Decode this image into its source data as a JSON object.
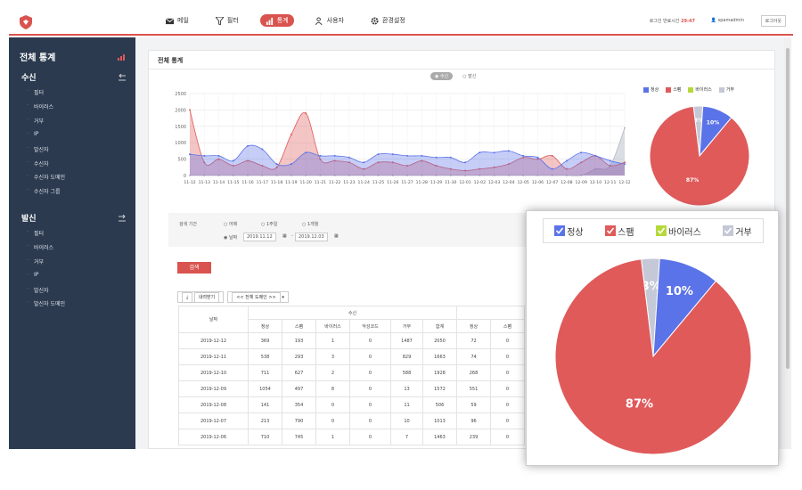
{
  "topbar": {
    "nav": [
      {
        "label": "메일",
        "icon": "mail-icon"
      },
      {
        "label": "필터",
        "icon": "filter-icon"
      },
      {
        "label": "통계",
        "icon": "chart-icon"
      },
      {
        "label": "사용자",
        "icon": "users-icon"
      },
      {
        "label": "환경설정",
        "icon": "gear-icon"
      }
    ],
    "login_label": "로그인 만료시간",
    "login_time": "29:47",
    "user": "spamadmin",
    "logout": "로그아웃"
  },
  "sidebar": {
    "title": "전체 통계",
    "recv_title": "수신",
    "recv_items": [
      "필터",
      "바이러스",
      "거부",
      "IP",
      "발신자",
      "수신자",
      "수신자 도메인",
      "수신자 그룹"
    ],
    "send_title": "발신",
    "send_items": [
      "필터",
      "바이러스",
      "거부",
      "IP",
      "발신자",
      "발신자 도메인"
    ]
  },
  "panel": {
    "title": "전체 통계",
    "toggle_recv": "수신",
    "toggle_send": "발신",
    "legend": [
      "정상",
      "스팸",
      "바이러스",
      "거부"
    ]
  },
  "colors": {
    "normal": "#5b73e8",
    "spam": "#e05a5a",
    "virus": "#b6d93a",
    "reject": "#c5c8d6",
    "accent": "#d9534f"
  },
  "chart_data": [
    {
      "type": "area",
      "categories": [
        "11-12",
        "11-13",
        "11-14",
        "11-15",
        "11-16",
        "11-17",
        "11-18",
        "11-19",
        "11-20",
        "11-21",
        "11-22",
        "11-23",
        "11-24",
        "11-25",
        "11-26",
        "11-27",
        "11-28",
        "11-29",
        "11-30",
        "12-01",
        "12-02",
        "12-03",
        "12-04",
        "12-05",
        "12-06",
        "12-07",
        "12-08",
        "12-09",
        "12-10",
        "12-11",
        "12-12"
      ],
      "ylim": [
        0,
        2500
      ],
      "yticks": [
        "2500",
        "2000",
        "1500",
        "1000",
        "500",
        "0"
      ],
      "series": [
        {
          "name": "스팸",
          "values": [
            2000,
            400,
            500,
            300,
            450,
            300,
            250,
            1250,
            1900,
            500,
            450,
            400,
            200,
            400,
            400,
            300,
            450,
            300,
            200,
            150,
            200,
            250,
            350,
            550,
            500,
            600,
            200,
            400,
            600,
            300,
            400
          ]
        },
        {
          "name": "정상",
          "values": [
            650,
            600,
            600,
            450,
            900,
            800,
            350,
            350,
            700,
            600,
            600,
            550,
            400,
            650,
            650,
            600,
            600,
            550,
            550,
            400,
            700,
            700,
            750,
            600,
            550,
            200,
            450,
            700,
            600,
            450,
            350
          ]
        },
        {
          "name": "거부",
          "values": [
            0,
            0,
            0,
            0,
            0,
            0,
            0,
            0,
            0,
            0,
            0,
            0,
            0,
            0,
            0,
            0,
            0,
            0,
            0,
            0,
            0,
            0,
            0,
            0,
            0,
            0,
            0,
            0,
            200,
            300,
            1450
          ]
        }
      ]
    },
    {
      "type": "pie",
      "labels": [
        "스팸",
        "정상",
        "거부"
      ],
      "values": [
        87,
        10,
        3
      ],
      "value_labels": [
        "87%",
        "10%",
        "3%"
      ]
    }
  ],
  "filter": {
    "period_label": "검색 기간",
    "opt_yesterday": "어제",
    "opt_week": "1주일",
    "opt_month": "1개월",
    "opt_date": "날짜",
    "date_from": "2019.11.12",
    "date_to": "2019.12.03",
    "search": "검색"
  },
  "tools": {
    "download": "내려받기",
    "domain_select": "<< 전체 도메인 >>"
  },
  "table": {
    "date_header": "날짜",
    "group_header": "수신",
    "columns": [
      "정상",
      "스팸",
      "바이러스",
      "악성코드",
      "거부",
      "합계",
      "정상",
      "스팸"
    ],
    "rows": [
      [
        "2019-12-12",
        "369",
        "193",
        "1",
        "0",
        "1487",
        "2050",
        "72",
        "0"
      ],
      [
        "2019-12-11",
        "538",
        "293",
        "3",
        "0",
        "829",
        "1663",
        "74",
        "0"
      ],
      [
        "2019-12-10",
        "711",
        "627",
        "2",
        "0",
        "588",
        "1928",
        "268",
        "0"
      ],
      [
        "2019-12-09",
        "1054",
        "497",
        "8",
        "0",
        "13",
        "1572",
        "551",
        "0"
      ],
      [
        "2019-12-08",
        "141",
        "354",
        "0",
        "0",
        "11",
        "506",
        "59",
        "0"
      ],
      [
        "2019-12-07",
        "213",
        "790",
        "0",
        "0",
        "10",
        "1013",
        "96",
        "0"
      ],
      [
        "2019-12-06",
        "710",
        "745",
        "1",
        "0",
        "7",
        "1463",
        "239",
        "0"
      ]
    ]
  }
}
